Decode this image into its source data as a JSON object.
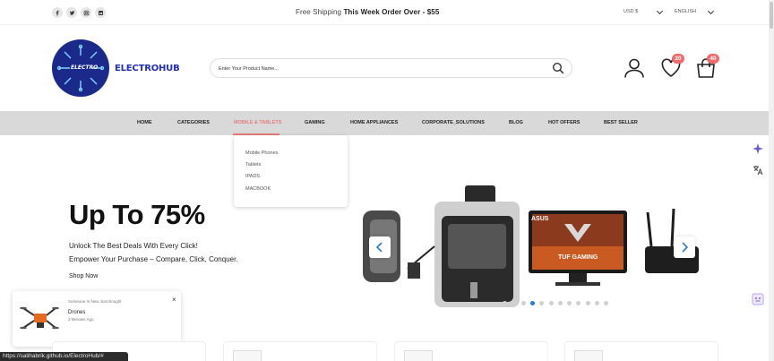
{
  "topbar": {
    "social_icons": [
      "facebook-icon",
      "twitter-icon",
      "instagram-icon",
      "linkedin-icon"
    ],
    "shipping_prefix": "Free Shipping",
    "shipping_bold": "This Week Order Over - $55",
    "currency": "USD $",
    "language": "ENGLISH"
  },
  "header": {
    "logo_text": "ELECTRO",
    "brand": "ELECTROHUB",
    "search_placeholder": "Enter Your Product Name...",
    "wishlist_count": "20",
    "cart_count": "40"
  },
  "nav": {
    "items": [
      "HOME",
      "CATEGORIES",
      "MOBILE & TABLETS",
      "GAMING",
      "HOME APPLIANCES",
      "CORPORATE_SOLUTIONS",
      "BLOG",
      "HOT OFFERS",
      "BEST SELLER"
    ],
    "active": "MOBILE & TABLETS",
    "dropdown": [
      "Mobile Phones",
      "Tablets",
      "IPADS",
      "MACBOOK"
    ]
  },
  "hero": {
    "heading": "Up To 75%",
    "line1": "Unlock The Best Deals With Every Click!",
    "line2": "Empower Your Purchase – Compare, Click, Conquer.",
    "cta": "Shop Now",
    "slide_count": 12,
    "active_slide": 3,
    "slide_text": [
      "ASUS",
      "TUF GAMING"
    ]
  },
  "toast": {
    "title": "Someone In New Just Bought",
    "product": "Drones",
    "time": "2 Minutes Ago",
    "close": "×"
  },
  "status_url": "https://salihabrik.github.io/ElectroHub/#",
  "colors": {
    "accent": "#e87d7d",
    "brand": "#1e2fb8",
    "active_dot": "#1f7fd9",
    "nav_bg": "#d9d9d9"
  }
}
